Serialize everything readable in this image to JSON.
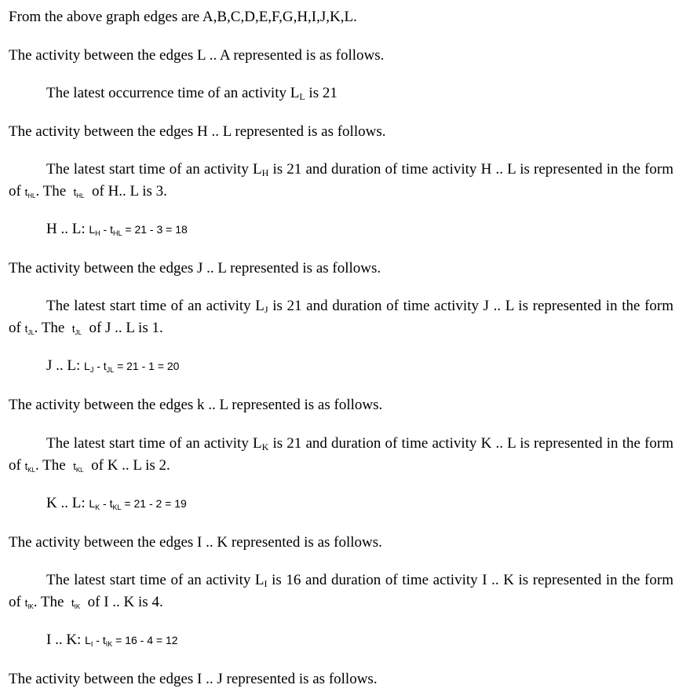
{
  "intro": "From the above graph edges are A,B,C,D,E,F,G,H,I,J,K,L.",
  "sections": [
    {
      "heading": "The activity between the edges L .. A represented is as follows.",
      "body_prefix": "The latest occurrence time of an activity L",
      "body_sub": "L",
      "body_suffix": " is 21"
    },
    {
      "heading": "The activity between the edges H .. L represented is as follows.",
      "p1_prefix": "The latest start time of an activity L",
      "p1_sub": "H",
      "p1_mid": " is 21 and duration of time activity H .. L  is  represented in the form of ",
      "t_sym": "t",
      "t_sub": "HL",
      "p1_mid2": ". The ",
      "p1_end": " of  H.. L is 3.",
      "eq_label": "H .. L:",
      "eq_L": "L",
      "eq_L_sub": "H",
      "eq_rest": "= 21 - 3 = 18"
    },
    {
      "heading": "The activity between the edges J .. L represented is as follows.",
      "p1_prefix": "The latest start time of an activity L",
      "p1_sub": "J",
      "p1_mid": " is 21 and duration of time activity J .. L  is  represented in the form of ",
      "t_sym": "t",
      "t_sub": "JL",
      "p1_mid2": ". The ",
      "p1_end": " of  J .. L is 1.",
      "eq_label": "J .. L:",
      "eq_L": "L",
      "eq_L_sub": "J",
      "eq_rest": "= 21 - 1 = 20"
    },
    {
      "heading": "The activity between the edges k .. L represented is as follows.",
      "p1_prefix": "The latest start time of an activity L",
      "p1_sub": "K",
      "p1_mid": " is 21 and duration of time activity K .. L  is  represented in the form of ",
      "t_sym": "t",
      "t_sub": "KL",
      "p1_mid2": ". The ",
      "p1_end": " of  K .. L is 2.",
      "eq_label": "K .. L:",
      "eq_L": "L",
      "eq_L_sub": "K",
      "eq_rest": "= 21 - 2 = 19"
    },
    {
      "heading": "The activity between the edges I .. K represented is as follows.",
      "p1_prefix": "The latest start time of an activity L",
      "p1_sub": "I",
      "p1_mid": " is 16 and duration of time activity I .. K  is  represented in the form of ",
      "t_sym": "t",
      "t_sub": "IK",
      "p1_mid2": ". The ",
      "p1_end": " of  I .. K is 4.",
      "eq_label": "I .. K:",
      "eq_L": "L",
      "eq_L_sub": "I",
      "eq_rest": "= 16 - 4 = 12"
    },
    {
      "heading": "The activity between the edges I .. J represented is as follows."
    }
  ]
}
